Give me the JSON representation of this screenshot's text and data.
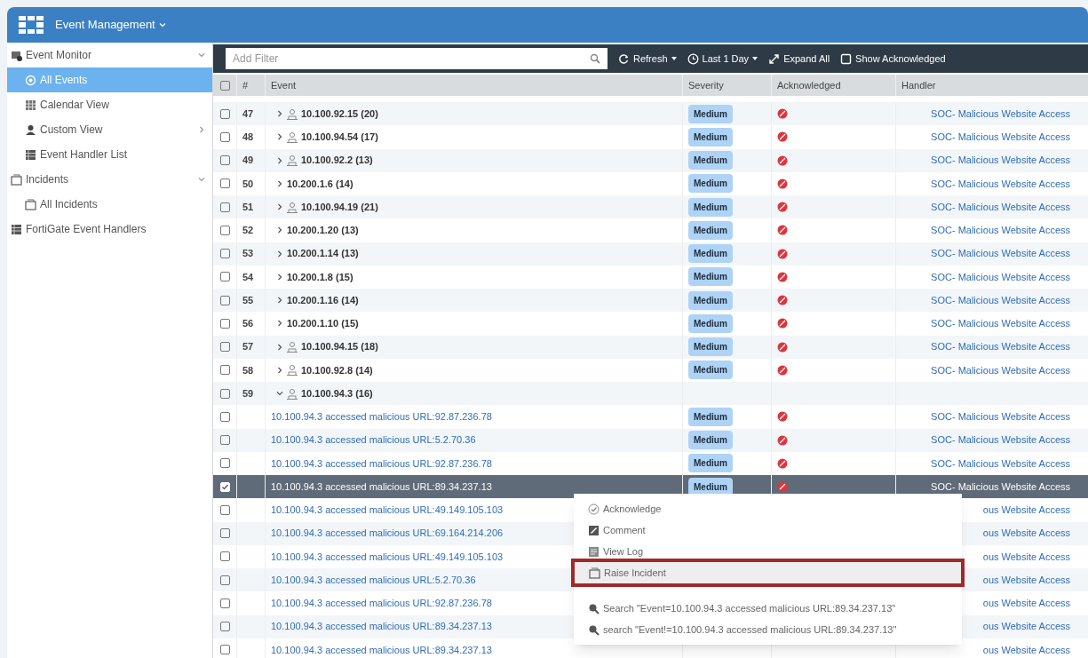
{
  "header": {
    "title": "Event Management"
  },
  "sidebar": {
    "items": [
      {
        "label": "Event Monitor",
        "expanded": true,
        "selected": false,
        "children": [
          {
            "label": "All Events",
            "selected": true,
            "has_submenu": false
          },
          {
            "label": "Calendar View",
            "selected": false,
            "has_submenu": false
          },
          {
            "label": "Custom View",
            "selected": false,
            "has_submenu": true
          },
          {
            "label": "Event Handler List",
            "selected": false,
            "has_submenu": false
          }
        ]
      },
      {
        "label": "Incidents",
        "expanded": true,
        "selected": false,
        "children": [
          {
            "label": "All Incidents",
            "selected": false,
            "has_submenu": false
          }
        ]
      },
      {
        "label": "FortiGate Event Handlers",
        "selected": false
      }
    ]
  },
  "toolbar": {
    "filter": {
      "placeholder": "Add Filter"
    },
    "buttons": [
      {
        "label": "Refresh",
        "dropdown": true
      },
      {
        "label": "Last 1 Day",
        "dropdown": true
      },
      {
        "label": "Expand All",
        "dropdown": false
      },
      {
        "label": "Show Acknowledged",
        "dropdown": false
      }
    ]
  },
  "table": {
    "columns": [
      "#",
      "Event",
      "Severity",
      "Acknowledged",
      "Handler"
    ],
    "rows": [
      {
        "kind": "group",
        "checked": false,
        "number": "47",
        "event": "10.100.92.15 (20)",
        "user_icon": true,
        "expanded": false,
        "severity": "Medium",
        "acknowledged": false,
        "handler": "SOC- Malicious Website Access"
      },
      {
        "kind": "group",
        "checked": false,
        "number": "48",
        "event": "10.100.94.54 (17)",
        "user_icon": true,
        "expanded": false,
        "severity": "Medium",
        "acknowledged": false,
        "handler": "SOC- Malicious Website Access"
      },
      {
        "kind": "group",
        "checked": false,
        "number": "49",
        "event": "10.100.92.2 (13)",
        "user_icon": true,
        "expanded": false,
        "severity": "Medium",
        "acknowledged": false,
        "handler": "SOC- Malicious Website Access"
      },
      {
        "kind": "group",
        "checked": false,
        "number": "50",
        "event": "10.200.1.6 (14)",
        "user_icon": false,
        "expanded": false,
        "severity": "Medium",
        "acknowledged": false,
        "handler": "SOC- Malicious Website Access"
      },
      {
        "kind": "group",
        "checked": false,
        "number": "51",
        "event": "10.100.94.19 (21)",
        "user_icon": true,
        "expanded": false,
        "severity": "Medium",
        "acknowledged": false,
        "handler": "SOC- Malicious Website Access"
      },
      {
        "kind": "group",
        "checked": false,
        "number": "52",
        "event": "10.200.1.20 (13)",
        "user_icon": false,
        "expanded": false,
        "severity": "Medium",
        "acknowledged": false,
        "handler": "SOC- Malicious Website Access"
      },
      {
        "kind": "group",
        "checked": false,
        "number": "53",
        "event": "10.200.1.14 (13)",
        "user_icon": false,
        "expanded": false,
        "severity": "Medium",
        "acknowledged": false,
        "handler": "SOC- Malicious Website Access"
      },
      {
        "kind": "group",
        "checked": false,
        "number": "54",
        "event": "10.200.1.8 (15)",
        "user_icon": false,
        "expanded": false,
        "severity": "Medium",
        "acknowledged": false,
        "handler": "SOC- Malicious Website Access"
      },
      {
        "kind": "group",
        "checked": false,
        "number": "55",
        "event": "10.200.1.16 (14)",
        "user_icon": false,
        "expanded": false,
        "severity": "Medium",
        "acknowledged": false,
        "handler": "SOC- Malicious Website Access"
      },
      {
        "kind": "group",
        "checked": false,
        "number": "56",
        "event": "10.200.1.10 (15)",
        "user_icon": false,
        "expanded": false,
        "severity": "Medium",
        "acknowledged": false,
        "handler": "SOC- Malicious Website Access"
      },
      {
        "kind": "group",
        "checked": false,
        "number": "57",
        "event": "10.100.94.15 (18)",
        "user_icon": true,
        "expanded": false,
        "severity": "Medium",
        "acknowledged": false,
        "handler": "SOC- Malicious Website Access"
      },
      {
        "kind": "group",
        "checked": false,
        "number": "58",
        "event": "10.100.92.8 (14)",
        "user_icon": true,
        "expanded": false,
        "severity": "Medium",
        "acknowledged": false,
        "handler": "SOC- Malicious Website Access"
      },
      {
        "kind": "group",
        "checked": false,
        "number": "59",
        "event": "10.100.94.3 (16)",
        "user_icon": true,
        "expanded": true
      },
      {
        "kind": "event",
        "checked": false,
        "selected": false,
        "event": "10.100.94.3 accessed malicious URL:92.87.236.78",
        "severity": "Medium",
        "acknowledged": false,
        "handler": "SOC- Malicious Website Access"
      },
      {
        "kind": "event",
        "checked": false,
        "selected": false,
        "event": "10.100.94.3 accessed malicious URL:5.2.70.36",
        "severity": "Medium",
        "acknowledged": false,
        "handler": "SOC- Malicious Website Access"
      },
      {
        "kind": "event",
        "checked": false,
        "selected": false,
        "event": "10.100.94.3 accessed malicious URL:92.87.236.78",
        "severity": "Medium",
        "acknowledged": false,
        "handler": "SOC- Malicious Website Access"
      },
      {
        "kind": "event",
        "checked": true,
        "selected": true,
        "event": "10.100.94.3 accessed malicious URL:89.34.237.13",
        "severity": "Medium",
        "acknowledged": false,
        "handler": "SOC- Malicious Website Access"
      },
      {
        "kind": "event",
        "checked": false,
        "selected": false,
        "event": "10.100.94.3 accessed malicious URL:49.149.105.103",
        "handler": "ous Website Access"
      },
      {
        "kind": "event",
        "checked": false,
        "selected": false,
        "event": "10.100.94.3 accessed malicious URL:69.164.214.206",
        "handler": "ous Website Access"
      },
      {
        "kind": "event",
        "checked": false,
        "selected": false,
        "event": "10.100.94.3 accessed malicious URL:49.149.105.103",
        "handler": "ous Website Access"
      },
      {
        "kind": "event",
        "checked": false,
        "selected": false,
        "event": "10.100.94.3 accessed malicious URL:5.2.70.36",
        "handler": "ous Website Access"
      },
      {
        "kind": "event",
        "checked": false,
        "selected": false,
        "event": "10.100.94.3 accessed malicious URL:92.87.236.78",
        "handler": "ous Website Access"
      },
      {
        "kind": "event",
        "checked": false,
        "selected": false,
        "event": "10.100.94.3 accessed malicious URL:89.34.237.13",
        "handler": "ous Website Access"
      },
      {
        "kind": "event",
        "checked": false,
        "selected": false,
        "event": "10.100.94.3 accessed malicious URL:89.34.237.13",
        "handler": "ous Website Access"
      }
    ]
  },
  "context_menu": {
    "items": [
      {
        "label": "Acknowledge",
        "highlighted": false
      },
      {
        "label": "Comment",
        "highlighted": false
      },
      {
        "label": "View Log",
        "highlighted": false
      },
      {
        "label": "Raise Incident",
        "highlighted": true
      },
      {
        "label": "Search \"Event=10.100.94.3 accessed malicious URL:89.34.237.13\"",
        "highlighted": false
      },
      {
        "label": "search \"Event!=10.100.94.3 accessed malicious URL:89.34.237.13\"",
        "highlighted": false
      }
    ]
  }
}
